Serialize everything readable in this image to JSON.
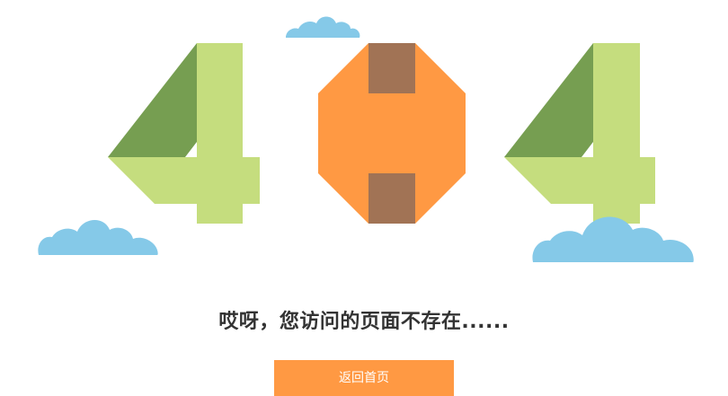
{
  "error": {
    "code_digits": [
      "4",
      "0",
      "4"
    ],
    "message": "哎呀，您访问的页面不存在......",
    "home_button_label": "返回首页"
  },
  "colors": {
    "four_light": "#c5dd7e",
    "four_dark": "#769e51",
    "zero_orange": "#ff9943",
    "zero_brown": "#a17355",
    "cloud": "#85c9e8",
    "button_bg": "#ff9943",
    "message_text": "#333333"
  },
  "icons": {
    "clouds": "cloud-icon"
  }
}
